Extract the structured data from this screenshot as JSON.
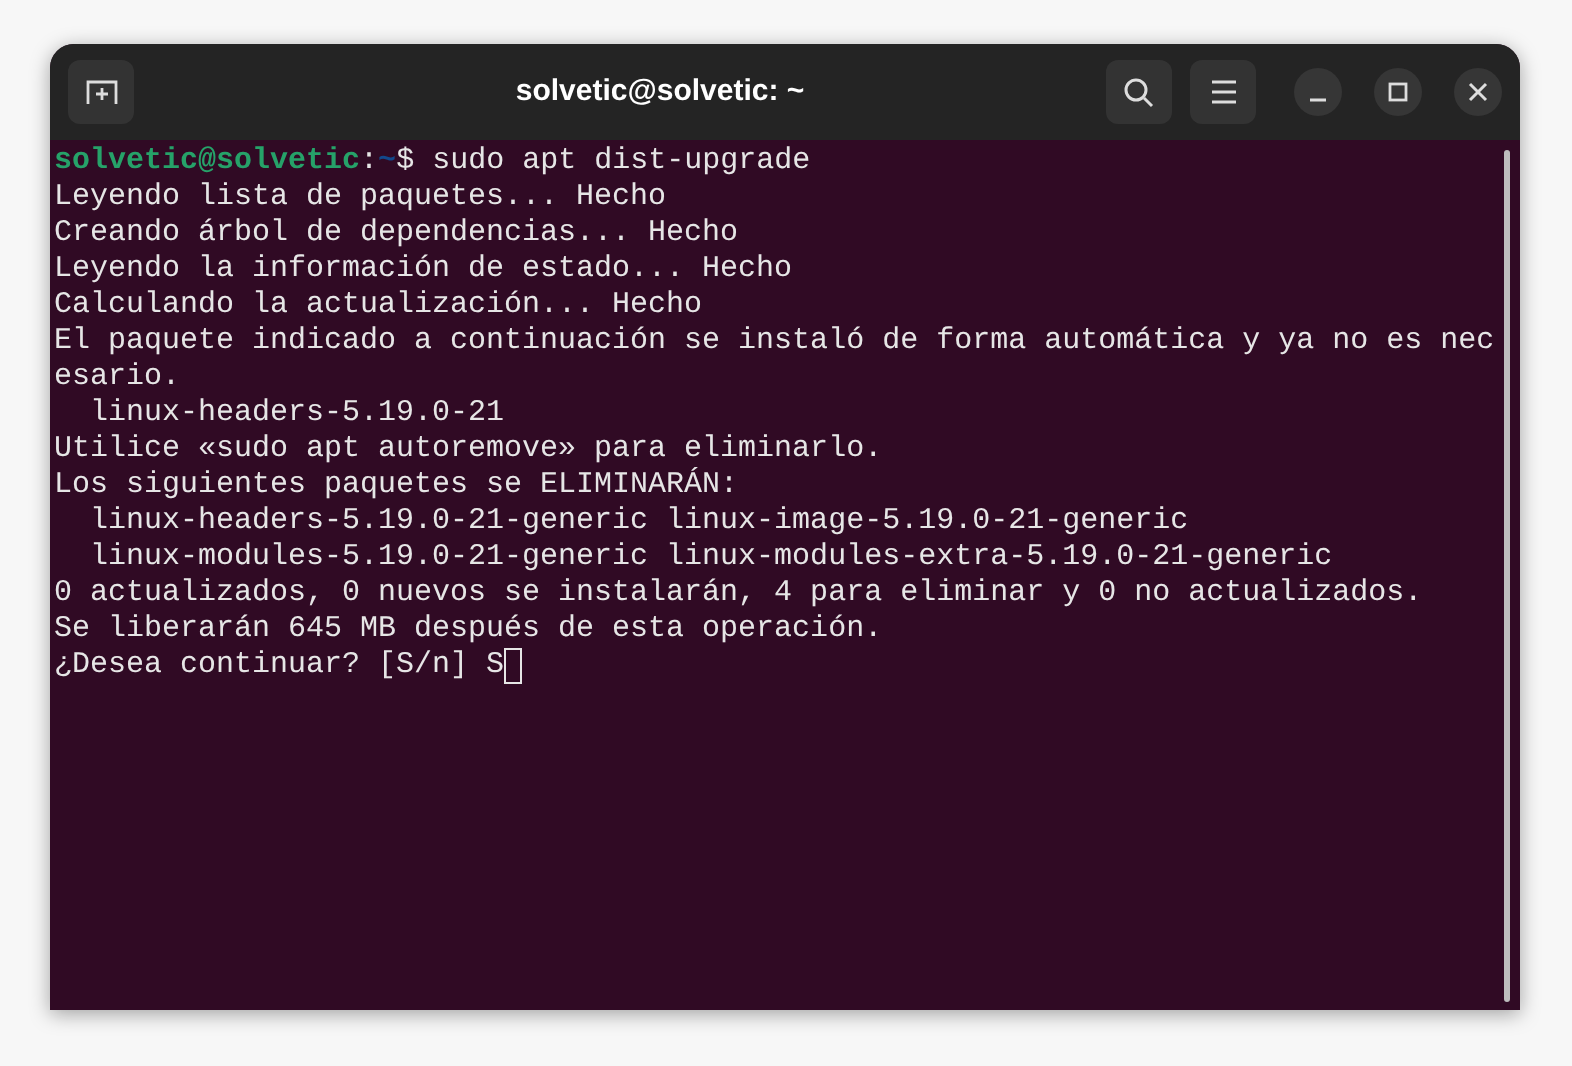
{
  "window": {
    "title": "solvetic@solvetic: ~"
  },
  "terminal": {
    "prompt": {
      "user_host": "solvetic@solvetic",
      "separator": ":",
      "path": "~",
      "symbol": "$",
      "command": "sudo apt dist-upgrade"
    },
    "lines": [
      "Leyendo lista de paquetes... Hecho",
      "Creando árbol de dependencias... Hecho",
      "Leyendo la información de estado... Hecho",
      "Calculando la actualización... Hecho",
      "El paquete indicado a continuación se instaló de forma automática y ya no es nec",
      "esario.",
      "  linux-headers-5.19.0-21",
      "Utilice «sudo apt autoremove» para eliminarlo.",
      "Los siguientes paquetes se ELIMINARÁN:",
      "  linux-headers-5.19.0-21-generic linux-image-5.19.0-21-generic",
      "  linux-modules-5.19.0-21-generic linux-modules-extra-5.19.0-21-generic",
      "0 actualizados, 0 nuevos se instalarán, 4 para eliminar y 0 no actualizados.",
      "Se liberarán 645 MB después de esta operación."
    ],
    "input_line": {
      "text": "¿Desea continuar? [S/n] S",
      "cursor": true
    }
  }
}
